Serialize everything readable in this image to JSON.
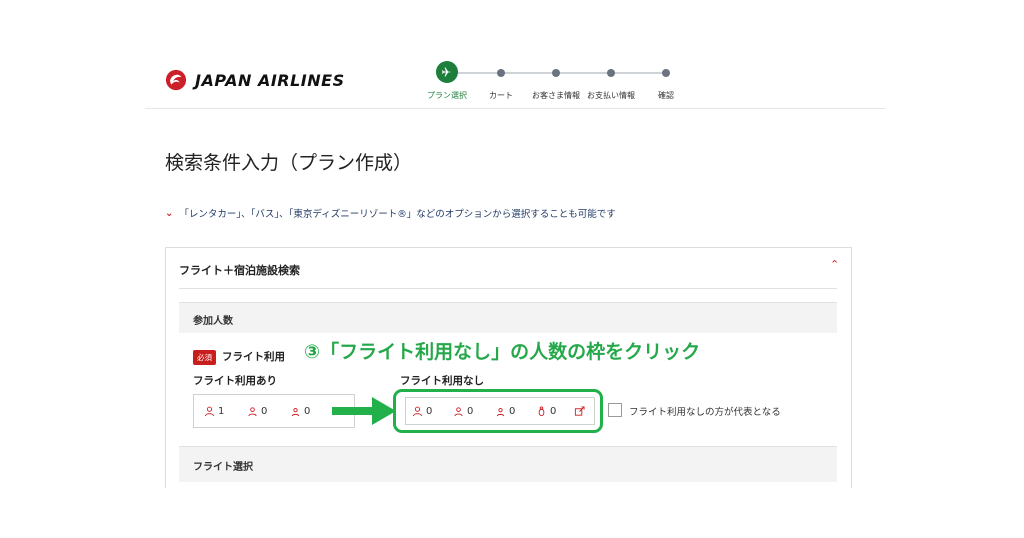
{
  "header": {
    "brand": "JAPAN AIRLINES",
    "steps": [
      {
        "label": "プラン選択",
        "active": true
      },
      {
        "label": "カート",
        "active": false
      },
      {
        "label": "お客さま情報",
        "active": false
      },
      {
        "label": "お支払い情報",
        "active": false
      },
      {
        "label": "確認",
        "active": false
      }
    ]
  },
  "page": {
    "title": "検索条件入力（プラン作成）",
    "notice": "「レンタカー」、「バス」、「東京ディズニーリゾート®」などのオプションから選択することも可能です"
  },
  "panel": {
    "title": "フライト＋宿泊施設検索",
    "passengers_section": "参加人数",
    "required_badge": "必須",
    "flight_use_label": "フライト利用",
    "with_flight_label": "フライト利用あり",
    "without_flight_label": "フライト利用なし",
    "with_flight_counts": [
      "1",
      "0",
      "0"
    ],
    "without_flight_counts": [
      "0",
      "0",
      "0",
      "0"
    ],
    "checkbox_label": "フライト利用なしの方が代表となる",
    "flight_section": "フライト選択"
  },
  "annotation": {
    "instruction": "③「フライト利用なし」の人数の枠をクリック",
    "highlight_color": "#22b04a"
  },
  "colors": {
    "brand_red": "#cc1f27",
    "step_active": "#1e7f3c"
  }
}
